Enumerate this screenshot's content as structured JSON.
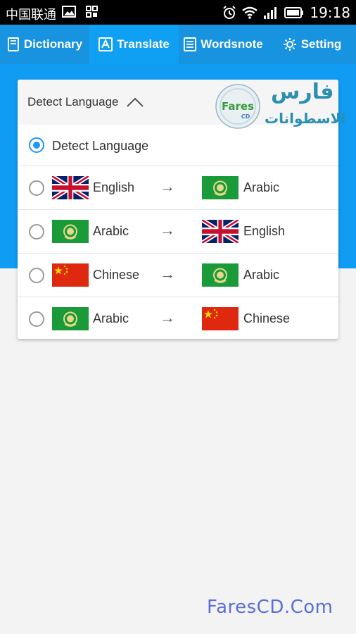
{
  "status_bar": {
    "carrier": "中国联通",
    "time": "19:18"
  },
  "tabs": [
    {
      "label": "Dictionary",
      "icon": "book-icon"
    },
    {
      "label": "Translate",
      "icon": "translate-icon",
      "active": true
    },
    {
      "label": "Wordsnote",
      "icon": "notebook-icon"
    },
    {
      "label": "Setting",
      "icon": "gear-icon"
    }
  ],
  "language_dropdown": {
    "selected": "Detect Language",
    "options": [
      {
        "label": "Detect Language",
        "checked": true
      },
      {
        "from": "English",
        "from_flag": "uk-flag",
        "to": "Arabic",
        "to_flag": "arab-league-flag",
        "checked": false
      },
      {
        "from": "Arabic",
        "from_flag": "arab-league-flag",
        "to": "English",
        "to_flag": "uk-flag",
        "checked": false
      },
      {
        "from": "Chinese",
        "from_flag": "china-flag",
        "to": "Arabic",
        "to_flag": "arab-league-flag",
        "checked": false
      },
      {
        "from": "Arabic",
        "from_flag": "arab-league-flag",
        "to": "Chinese",
        "to_flag": "china-flag",
        "checked": false
      }
    ],
    "arrow": "→"
  },
  "watermark": {
    "arabic_title": "فارس",
    "arabic_subtitle": "الاسطوانات",
    "logo_text": "Fares CD",
    "footer": "FaresCD.Com"
  },
  "colors": {
    "tab_bar": "#1793e0",
    "tab_active": "#0fa0f3",
    "band": "#0f9cf2",
    "radio_checked": "#2196f3"
  }
}
